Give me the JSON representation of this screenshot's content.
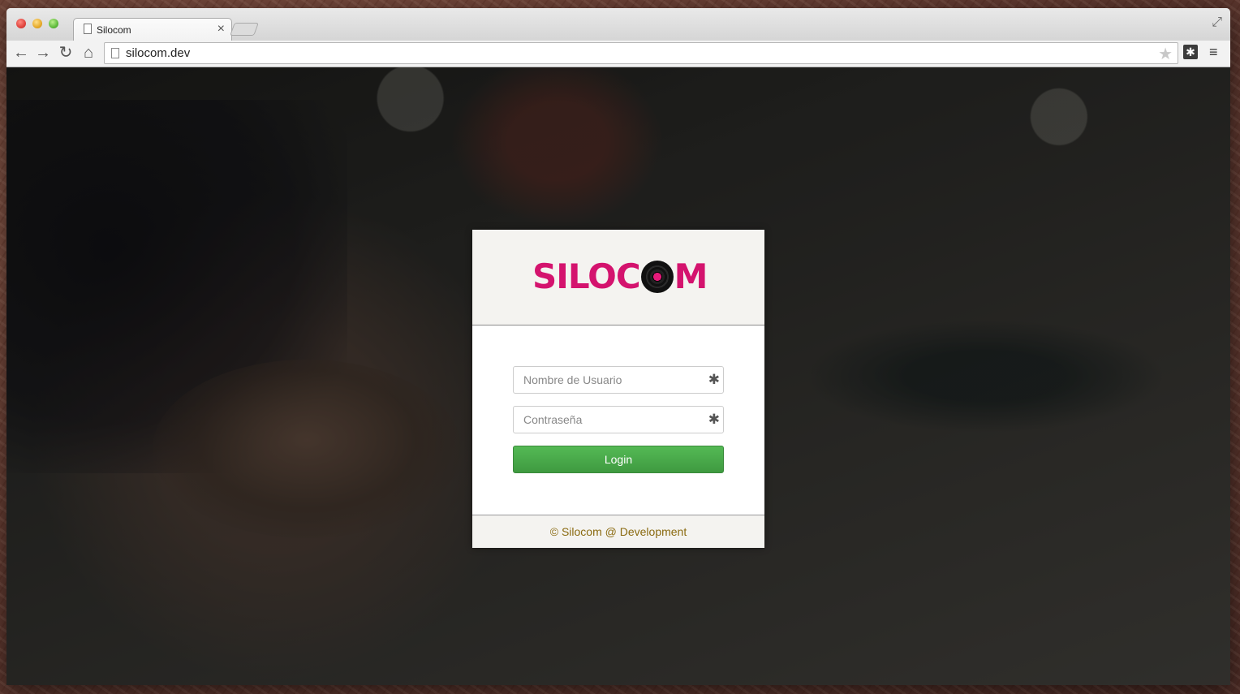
{
  "browser": {
    "tab_title": "Silocom",
    "tab_close": "×",
    "url": "silocom.dev",
    "back": "←",
    "forward": "→",
    "reload": "↻",
    "home": "⌂",
    "star": "★",
    "extension": "✱",
    "menu": "≡",
    "fullscreen": "⤢"
  },
  "login": {
    "logo_left": "SILOC",
    "logo_right": "M",
    "username_placeholder": "Nombre de Usuario",
    "password_placeholder": "Contraseña",
    "required_marker": "✱",
    "button_label": "Login",
    "footer": "© Silocom @ Development"
  },
  "colors": {
    "brand": "#d4136e",
    "button": "#4cae4c",
    "footer_text": "#8a6a10"
  }
}
